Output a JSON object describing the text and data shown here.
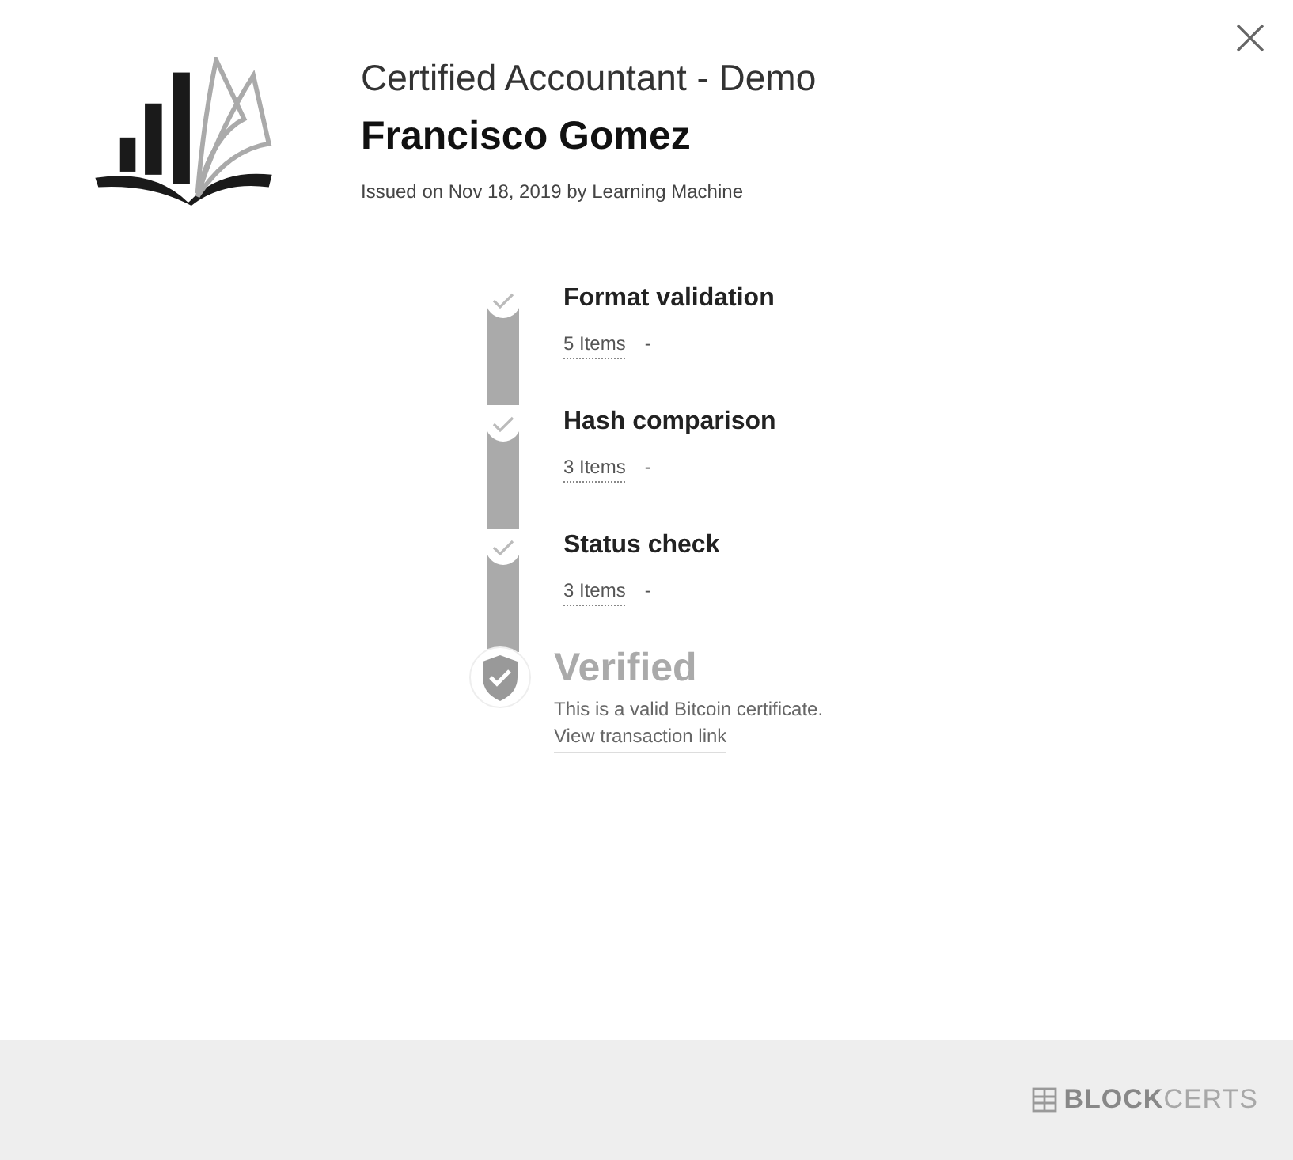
{
  "certificate": {
    "title": "Certified Accountant - Demo",
    "recipient": "Francisco Gomez",
    "issued": "Issued on Nov 18, 2019 by Learning Machine"
  },
  "steps": [
    {
      "title": "Format validation",
      "items": "5 Items",
      "toggle": "-",
      "passed": true
    },
    {
      "title": "Hash comparison",
      "items": "3 Items",
      "toggle": "-",
      "passed": true
    },
    {
      "title": "Status check",
      "items": "3 Items",
      "toggle": "-",
      "passed": true
    }
  ],
  "result": {
    "title": "Verified",
    "message": "This is a valid Bitcoin certificate.",
    "link": "View transaction link",
    "verified": true
  },
  "footer": {
    "brand": "**BLOCK**CERTS"
  }
}
